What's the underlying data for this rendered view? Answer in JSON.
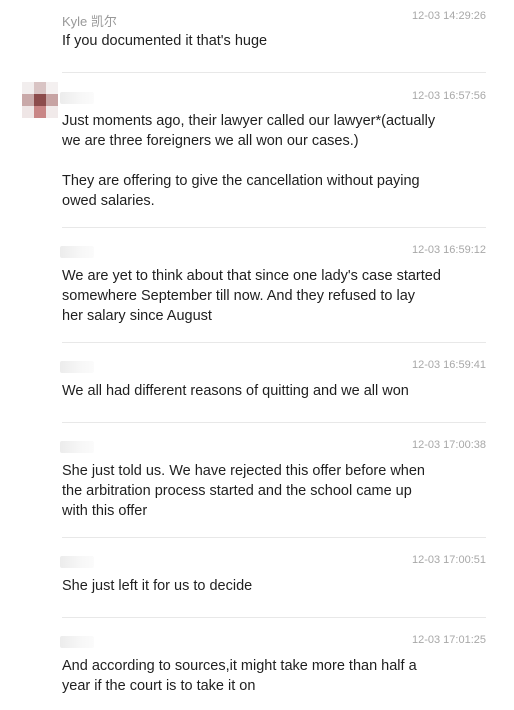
{
  "messages": [
    {
      "sender": "Kyle 凯尔",
      "time": "12-03 14:29:26",
      "text": "If you documented it that's huge"
    },
    {
      "sender": "",
      "time": "12-03 16:57:56",
      "text": "Just moments ago, their lawyer called our lawyer*(actually\nwe are three foreigners we all won our cases.)\n\nThey are offering to give the cancellation without paying\nowed salaries."
    },
    {
      "sender": "",
      "time": "12-03 16:59:12",
      "text": "We are yet to think about that since one lady's case started\nsomewhere September till now. And they refused to lay\nher salary since August"
    },
    {
      "sender": "",
      "time": "12-03 16:59:41",
      "text": "We all had different reasons of quitting and we all won"
    },
    {
      "sender": "",
      "time": "12-03 17:00:38",
      "text": "She just told us. We have rejected this offer before when\nthe arbitration process started and the school came up\nwith this offer"
    },
    {
      "sender": "",
      "time": "12-03 17:00:51",
      "text": "She just left it for us to decide"
    },
    {
      "sender": "",
      "time": "12-03 17:01:25",
      "text": "And according to sources,it might take more than half a\nyear if the court is to take it on"
    }
  ]
}
